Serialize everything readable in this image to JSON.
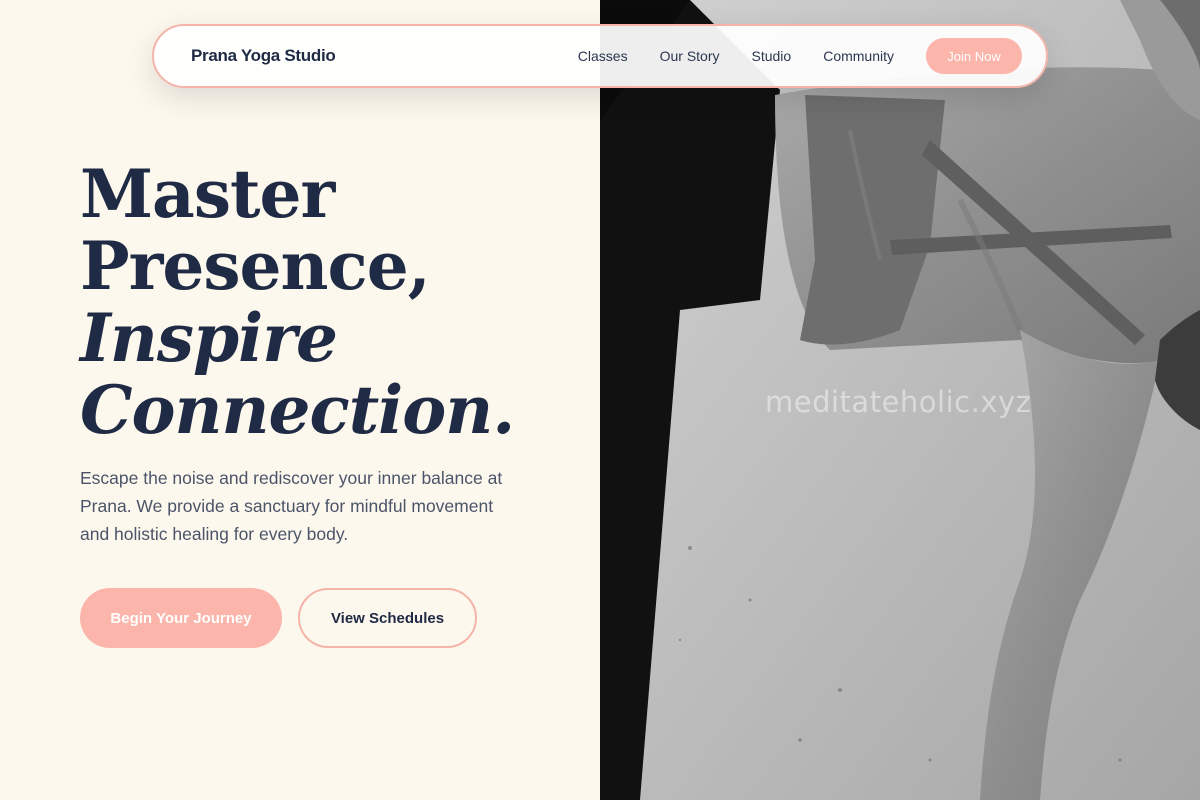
{
  "nav": {
    "brand": "Prana Yoga Studio",
    "links": [
      "Classes",
      "Our Story",
      "Studio",
      "Community"
    ],
    "join_label": "Join Now"
  },
  "hero": {
    "headline": {
      "line1": "Master",
      "line2": "Presence,",
      "line3": "Inspire",
      "line4": "Connection."
    },
    "lead": "Escape the noise and rediscover your inner balance at Prana. We provide a sanctuary for mindful movement and holistic healing for every body.",
    "primary_cta": "Begin Your Journey",
    "secondary_cta": "View Schedules"
  },
  "photo": {
    "watermark": "meditateholic.xyz"
  },
  "colors": {
    "background": "#fdf8ee",
    "accent": "#fbb5ab",
    "text": "#1f2a44"
  }
}
